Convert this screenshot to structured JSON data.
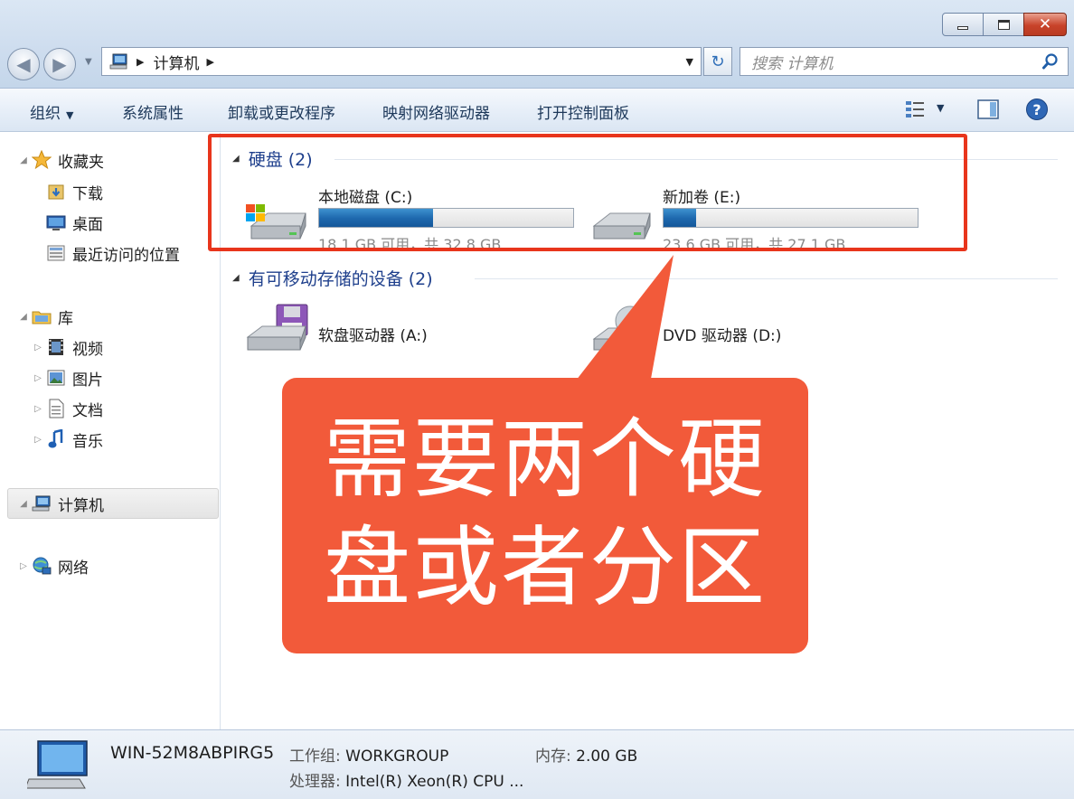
{
  "window": {
    "controls": {
      "minimize": "minimize",
      "maximize": "maximize",
      "close": "✕"
    }
  },
  "address_bar": {
    "path": "计算机",
    "search_placeholder": "搜索 计算机"
  },
  "toolbar": {
    "organize": "组织",
    "system_properties": "系统属性",
    "uninstall": "卸载或更改程序",
    "map_drive": "映射网络驱动器",
    "control_panel": "打开控制面板"
  },
  "sidebar": {
    "favorites": "收藏夹",
    "downloads": "下载",
    "desktop": "桌面",
    "recent": "最近访问的位置",
    "libraries": "库",
    "videos": "视频",
    "pictures": "图片",
    "documents": "文档",
    "music": "音乐",
    "computer": "计算机",
    "network": "网络"
  },
  "content": {
    "hard_disks_header": "硬盘 (2)",
    "removable_header": "有可移动存储的设备 (2)",
    "drives": [
      {
        "name": "本地磁盘 (C:)",
        "info": "18.1 GB 可用，共 32.8 GB",
        "used_fraction": 0.448
      },
      {
        "name": "新加卷 (E:)",
        "info": "23.6 GB 可用，共 27.1 GB",
        "used_fraction": 0.129
      }
    ],
    "removable": [
      {
        "name": "软盘驱动器 (A:)"
      },
      {
        "name": "DVD 驱动器 (D:)"
      }
    ]
  },
  "annotation": {
    "line1": "需要两个硬",
    "line2": "盘或者分区"
  },
  "details": {
    "computer_name": "WIN-52M8ABPIRG5",
    "workgroup_label": "工作组:",
    "workgroup_value": "WORKGROUP",
    "memory_label": "内存:",
    "memory_value": "2.00 GB",
    "cpu_label": "处理器:",
    "cpu_value": "Intel(R) Xeon(R) CPU ..."
  },
  "colors": {
    "accent": "#1e3f8c",
    "highlight": "#e8351c",
    "callout": "#f25a3a"
  }
}
